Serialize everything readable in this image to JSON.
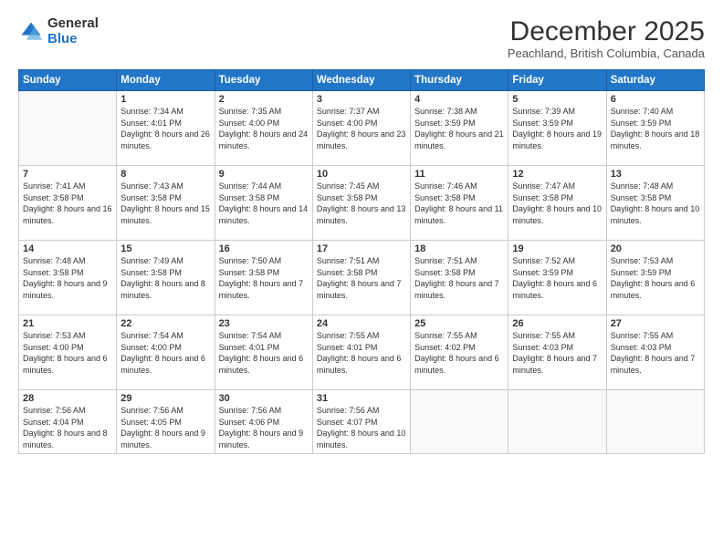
{
  "logo": {
    "general": "General",
    "blue": "Blue"
  },
  "title": "December 2025",
  "subtitle": "Peachland, British Columbia, Canada",
  "days_of_week": [
    "Sunday",
    "Monday",
    "Tuesday",
    "Wednesday",
    "Thursday",
    "Friday",
    "Saturday"
  ],
  "weeks": [
    [
      {
        "day": "",
        "sunrise": "",
        "sunset": "",
        "daylight": ""
      },
      {
        "day": "1",
        "sunrise": "Sunrise: 7:34 AM",
        "sunset": "Sunset: 4:01 PM",
        "daylight": "Daylight: 8 hours and 26 minutes."
      },
      {
        "day": "2",
        "sunrise": "Sunrise: 7:35 AM",
        "sunset": "Sunset: 4:00 PM",
        "daylight": "Daylight: 8 hours and 24 minutes."
      },
      {
        "day": "3",
        "sunrise": "Sunrise: 7:37 AM",
        "sunset": "Sunset: 4:00 PM",
        "daylight": "Daylight: 8 hours and 23 minutes."
      },
      {
        "day": "4",
        "sunrise": "Sunrise: 7:38 AM",
        "sunset": "Sunset: 3:59 PM",
        "daylight": "Daylight: 8 hours and 21 minutes."
      },
      {
        "day": "5",
        "sunrise": "Sunrise: 7:39 AM",
        "sunset": "Sunset: 3:59 PM",
        "daylight": "Daylight: 8 hours and 19 minutes."
      },
      {
        "day": "6",
        "sunrise": "Sunrise: 7:40 AM",
        "sunset": "Sunset: 3:59 PM",
        "daylight": "Daylight: 8 hours and 18 minutes."
      }
    ],
    [
      {
        "day": "7",
        "sunrise": "Sunrise: 7:41 AM",
        "sunset": "Sunset: 3:58 PM",
        "daylight": "Daylight: 8 hours and 16 minutes."
      },
      {
        "day": "8",
        "sunrise": "Sunrise: 7:43 AM",
        "sunset": "Sunset: 3:58 PM",
        "daylight": "Daylight: 8 hours and 15 minutes."
      },
      {
        "day": "9",
        "sunrise": "Sunrise: 7:44 AM",
        "sunset": "Sunset: 3:58 PM",
        "daylight": "Daylight: 8 hours and 14 minutes."
      },
      {
        "day": "10",
        "sunrise": "Sunrise: 7:45 AM",
        "sunset": "Sunset: 3:58 PM",
        "daylight": "Daylight: 8 hours and 13 minutes."
      },
      {
        "day": "11",
        "sunrise": "Sunrise: 7:46 AM",
        "sunset": "Sunset: 3:58 PM",
        "daylight": "Daylight: 8 hours and 11 minutes."
      },
      {
        "day": "12",
        "sunrise": "Sunrise: 7:47 AM",
        "sunset": "Sunset: 3:58 PM",
        "daylight": "Daylight: 8 hours and 10 minutes."
      },
      {
        "day": "13",
        "sunrise": "Sunrise: 7:48 AM",
        "sunset": "Sunset: 3:58 PM",
        "daylight": "Daylight: 8 hours and 10 minutes."
      }
    ],
    [
      {
        "day": "14",
        "sunrise": "Sunrise: 7:48 AM",
        "sunset": "Sunset: 3:58 PM",
        "daylight": "Daylight: 8 hours and 9 minutes."
      },
      {
        "day": "15",
        "sunrise": "Sunrise: 7:49 AM",
        "sunset": "Sunset: 3:58 PM",
        "daylight": "Daylight: 8 hours and 8 minutes."
      },
      {
        "day": "16",
        "sunrise": "Sunrise: 7:50 AM",
        "sunset": "Sunset: 3:58 PM",
        "daylight": "Daylight: 8 hours and 7 minutes."
      },
      {
        "day": "17",
        "sunrise": "Sunrise: 7:51 AM",
        "sunset": "Sunset: 3:58 PM",
        "daylight": "Daylight: 8 hours and 7 minutes."
      },
      {
        "day": "18",
        "sunrise": "Sunrise: 7:51 AM",
        "sunset": "Sunset: 3:58 PM",
        "daylight": "Daylight: 8 hours and 7 minutes."
      },
      {
        "day": "19",
        "sunrise": "Sunrise: 7:52 AM",
        "sunset": "Sunset: 3:59 PM",
        "daylight": "Daylight: 8 hours and 6 minutes."
      },
      {
        "day": "20",
        "sunrise": "Sunrise: 7:53 AM",
        "sunset": "Sunset: 3:59 PM",
        "daylight": "Daylight: 8 hours and 6 minutes."
      }
    ],
    [
      {
        "day": "21",
        "sunrise": "Sunrise: 7:53 AM",
        "sunset": "Sunset: 4:00 PM",
        "daylight": "Daylight: 8 hours and 6 minutes."
      },
      {
        "day": "22",
        "sunrise": "Sunrise: 7:54 AM",
        "sunset": "Sunset: 4:00 PM",
        "daylight": "Daylight: 8 hours and 6 minutes."
      },
      {
        "day": "23",
        "sunrise": "Sunrise: 7:54 AM",
        "sunset": "Sunset: 4:01 PM",
        "daylight": "Daylight: 8 hours and 6 minutes."
      },
      {
        "day": "24",
        "sunrise": "Sunrise: 7:55 AM",
        "sunset": "Sunset: 4:01 PM",
        "daylight": "Daylight: 8 hours and 6 minutes."
      },
      {
        "day": "25",
        "sunrise": "Sunrise: 7:55 AM",
        "sunset": "Sunset: 4:02 PM",
        "daylight": "Daylight: 8 hours and 6 minutes."
      },
      {
        "day": "26",
        "sunrise": "Sunrise: 7:55 AM",
        "sunset": "Sunset: 4:03 PM",
        "daylight": "Daylight: 8 hours and 7 minutes."
      },
      {
        "day": "27",
        "sunrise": "Sunrise: 7:55 AM",
        "sunset": "Sunset: 4:03 PM",
        "daylight": "Daylight: 8 hours and 7 minutes."
      }
    ],
    [
      {
        "day": "28",
        "sunrise": "Sunrise: 7:56 AM",
        "sunset": "Sunset: 4:04 PM",
        "daylight": "Daylight: 8 hours and 8 minutes."
      },
      {
        "day": "29",
        "sunrise": "Sunrise: 7:56 AM",
        "sunset": "Sunset: 4:05 PM",
        "daylight": "Daylight: 8 hours and 9 minutes."
      },
      {
        "day": "30",
        "sunrise": "Sunrise: 7:56 AM",
        "sunset": "Sunset: 4:06 PM",
        "daylight": "Daylight: 8 hours and 9 minutes."
      },
      {
        "day": "31",
        "sunrise": "Sunrise: 7:56 AM",
        "sunset": "Sunset: 4:07 PM",
        "daylight": "Daylight: 8 hours and 10 minutes."
      },
      {
        "day": "",
        "sunrise": "",
        "sunset": "",
        "daylight": ""
      },
      {
        "day": "",
        "sunrise": "",
        "sunset": "",
        "daylight": ""
      },
      {
        "day": "",
        "sunrise": "",
        "sunset": "",
        "daylight": ""
      }
    ]
  ]
}
